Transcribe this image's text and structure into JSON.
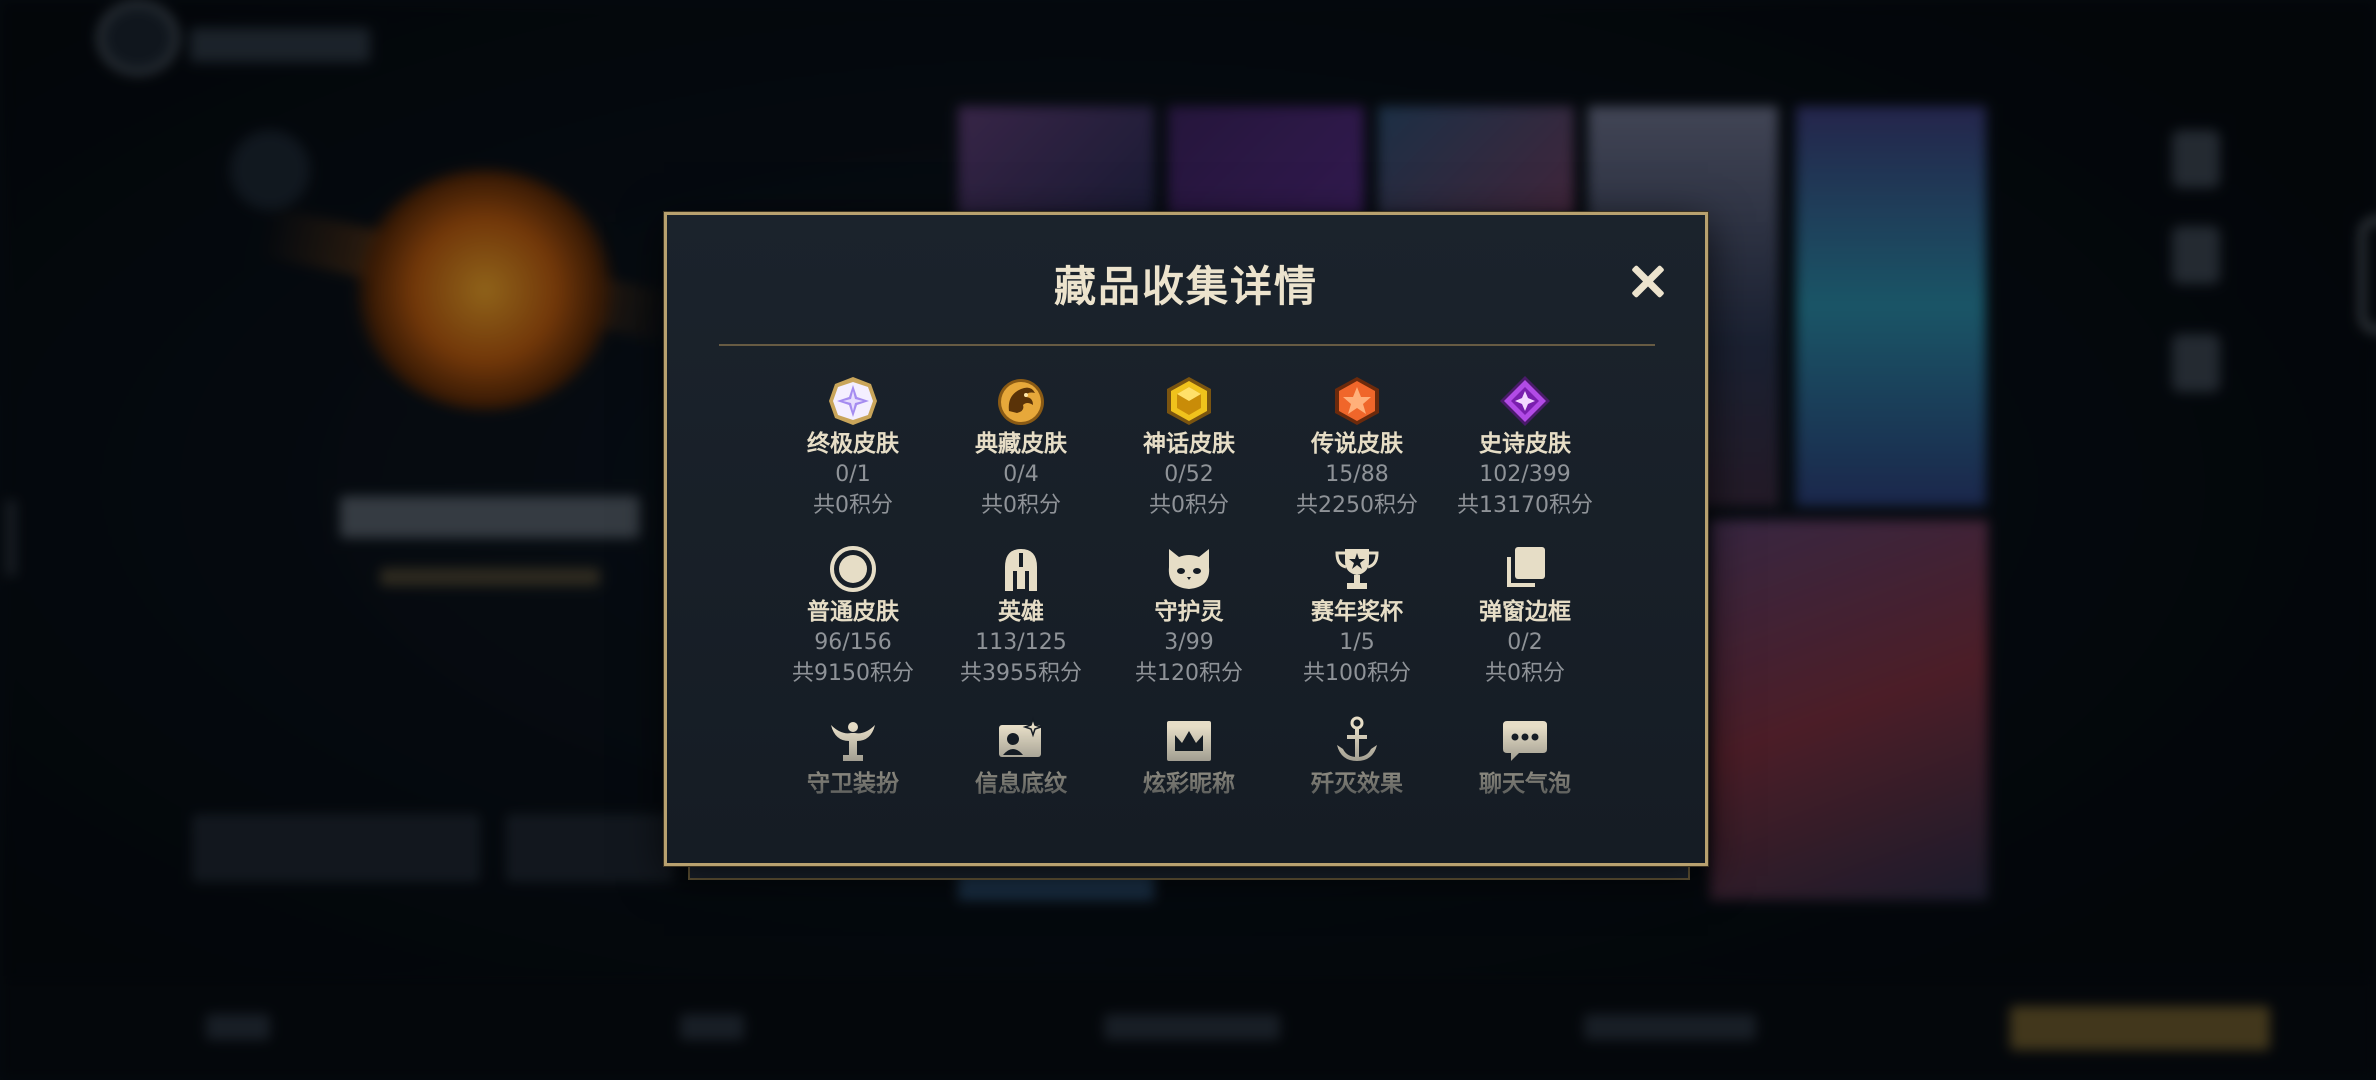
{
  "modal": {
    "title": "藏品收集详情",
    "close_icon": "close-icon"
  },
  "categories": [
    {
      "name": "终极皮肤",
      "count": "0/1",
      "points": "共0积分",
      "icon": "ultimate-skin-gem-icon",
      "color": "#b9a3ff"
    },
    {
      "name": "典藏皮肤",
      "count": "0/4",
      "points": "共0积分",
      "icon": "collection-skin-dragon-icon",
      "color": "#e7a83a"
    },
    {
      "name": "神话皮肤",
      "count": "0/52",
      "points": "共0积分",
      "icon": "mythic-skin-gem-icon",
      "color": "#f0c21c"
    },
    {
      "name": "传说皮肤",
      "count": "15/88",
      "points": "共2250积分",
      "icon": "legendary-skin-gem-icon",
      "color": "#f0662a"
    },
    {
      "name": "史诗皮肤",
      "count": "102/399",
      "points": "共13170积分",
      "icon": "epic-skin-gem-icon",
      "color": "#b24be6"
    },
    {
      "name": "普通皮肤",
      "count": "96/156",
      "points": "共9150积分",
      "icon": "normal-skin-circle-icon",
      "color": "#e6ddc6"
    },
    {
      "name": "英雄",
      "count": "113/125",
      "points": "共3955积分",
      "icon": "champion-helmet-icon",
      "color": "#e6ddc6"
    },
    {
      "name": "守护灵",
      "count": "3/99",
      "points": "共120积分",
      "icon": "guardian-spirit-icon",
      "color": "#e6ddc6"
    },
    {
      "name": "赛年奖杯",
      "count": "1/5",
      "points": "共100积分",
      "icon": "season-trophy-icon",
      "color": "#e6ddc6"
    },
    {
      "name": "弹窗边框",
      "count": "0/2",
      "points": "共0积分",
      "icon": "popup-frame-icon",
      "color": "#e6ddc6"
    },
    {
      "name": "守卫装扮",
      "icon": "ward-skin-icon",
      "color": "#e6ddc6"
    },
    {
      "name": "信息底纹",
      "icon": "info-card-icon",
      "color": "#e6ddc6"
    },
    {
      "name": "炫彩昵称",
      "icon": "colorful-nickname-icon",
      "color": "#e6ddc6"
    },
    {
      "name": "歼灭效果",
      "icon": "elimination-effect-icon",
      "color": "#e6ddc6"
    },
    {
      "name": "聊天气泡",
      "icon": "chat-bubble-icon",
      "color": "#e6ddc6"
    }
  ],
  "colors": {
    "modal_border": "#b8a16f",
    "title": "#ece3cd",
    "label": "#e6ddc6",
    "secondary": "#8f9398"
  }
}
